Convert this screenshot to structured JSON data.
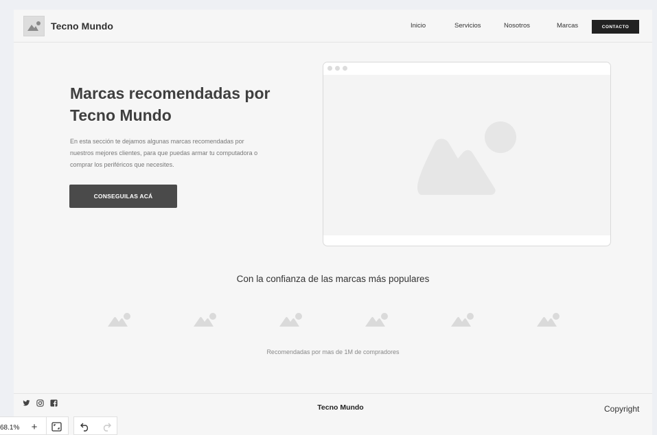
{
  "header": {
    "brand": "Tecno Mundo",
    "nav": [
      "Inicio",
      "Servicios",
      "Nosotros",
      "Marcas"
    ],
    "contact_label": "CONTACTO"
  },
  "hero": {
    "title": "Marcas recomendadas por Tecno Mundo",
    "description": "En esta sección te dejamos algunas marcas recomendadas por nuestros mejores clientes, para que puedas armar tu computadora o comprar los periféricos que necesites.",
    "cta_label": "CONSEGUILAS ACÁ"
  },
  "trust": {
    "title": "Con la confianza de las marcas más populares",
    "subtitle": "Recomendadas por mas de 1M de compradores",
    "logo_count": 6
  },
  "footer": {
    "brand": "Tecno Mundo",
    "copyright": "Copyright",
    "social_icons": [
      "twitter-icon",
      "instagram-icon",
      "facebook-icon"
    ]
  },
  "editor": {
    "zoom": "68.1%"
  },
  "colors": {
    "page_bg": "#f6f6f6",
    "dark_button": "#4a4a4a",
    "contact_button": "#222222",
    "placeholder": "#e6e6e6"
  }
}
